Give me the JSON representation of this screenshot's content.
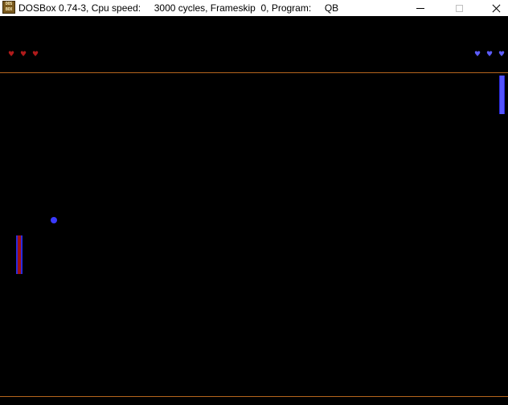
{
  "window": {
    "title": "DOSBox 0.74-3, Cpu speed:     3000 cycles, Frameskip  0, Program:     QB",
    "icon_label_top": "DOS",
    "icon_label_bottom": "BOX",
    "controls": {
      "minimize_icon": "minimize-icon",
      "maximize_icon": "maximize-icon",
      "close_icon": "close-icon"
    }
  },
  "game": {
    "player_left": {
      "lives": 3,
      "heart_glyph": "♥",
      "color": "#b01a1a"
    },
    "player_right": {
      "lives": 3,
      "heart_glyph": "♥",
      "color": "#5c5cff"
    },
    "colors": {
      "background": "#000000",
      "border": "#b5651d",
      "left_paddle": "#a01010",
      "right_paddle": "#5555ff",
      "ball": "#3a3aff"
    }
  }
}
